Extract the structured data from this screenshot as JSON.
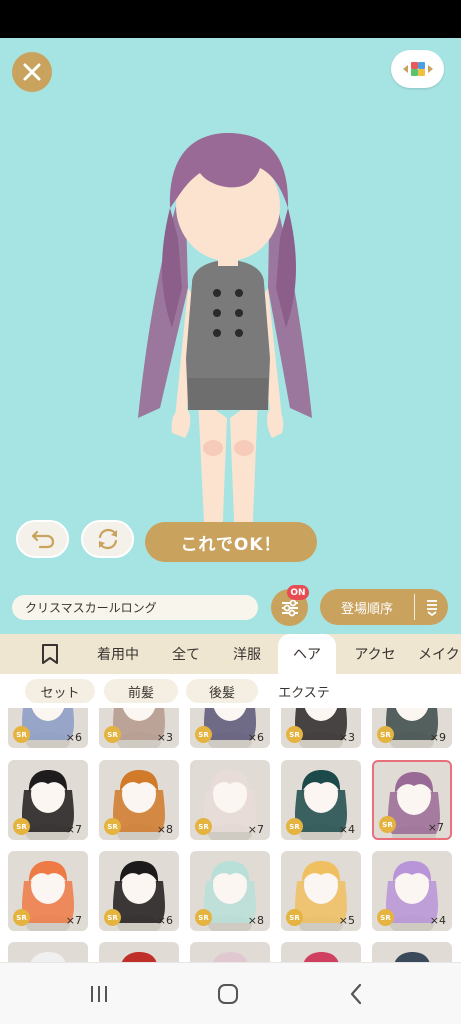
{
  "toolbar": {
    "item_name": "クリスマスカールロング",
    "filter_badge": "ON",
    "sort_label": "登場順序"
  },
  "actions": {
    "ok_label": "これでOK！"
  },
  "tabs": [
    "着用中",
    "全て",
    "洋服",
    "ヘア",
    "アクセ",
    "メイク"
  ],
  "active_tab": "ヘア",
  "subtabs": [
    "セット",
    "前髪",
    "後髪",
    "エクステ"
  ],
  "rarity_label": "SR",
  "items": [
    {
      "count": "×6",
      "hair": "#8a9bc7"
    },
    {
      "count": "×3",
      "hair": "#b49a8c"
    },
    {
      "count": "×6",
      "hair": "#5a5678"
    },
    {
      "count": "×3",
      "hair": "#2a2828"
    },
    {
      "count": "×9",
      "hair": "#3a4a48"
    },
    {
      "count": "×7",
      "hair": "#1e1c1c"
    },
    {
      "count": "×8",
      "hair": "#d07a2a"
    },
    {
      "count": "×7",
      "hair": "#e8dcd8"
    },
    {
      "count": "×4",
      "hair": "#1c4a4a"
    },
    {
      "count": "×7",
      "hair": "#9a6a96"
    },
    {
      "count": "×7",
      "hair": "#ee7a45"
    },
    {
      "count": "×6",
      "hair": "#1c1a1a"
    },
    {
      "count": "×8",
      "hair": "#b8e0d8"
    },
    {
      "count": "×5",
      "hair": "#f0c060"
    },
    {
      "count": "×4",
      "hair": "#b894d8"
    },
    {
      "count": "",
      "hair": "#f0f0f0"
    },
    {
      "count": "",
      "hair": "#c0302a"
    },
    {
      "count": "",
      "hair": "#e0c8d0"
    },
    {
      "count": "",
      "hair": "#d04060"
    },
    {
      "count": "",
      "hair": "#3a4a5a"
    }
  ],
  "selected_index": 9,
  "colors": {
    "stage_bg": "#a6e4e3",
    "gold": "#c9a25e",
    "hair": "#9a6a96",
    "badge_red": "#e94b52",
    "selected_border": "#e8707c"
  },
  "icons": [
    "close-icon",
    "palette-icon",
    "undo-icon",
    "rotate-icon",
    "filter-icon",
    "sort-icon",
    "bookmark-icon",
    "recent-apps-icon",
    "home-icon",
    "back-icon"
  ]
}
